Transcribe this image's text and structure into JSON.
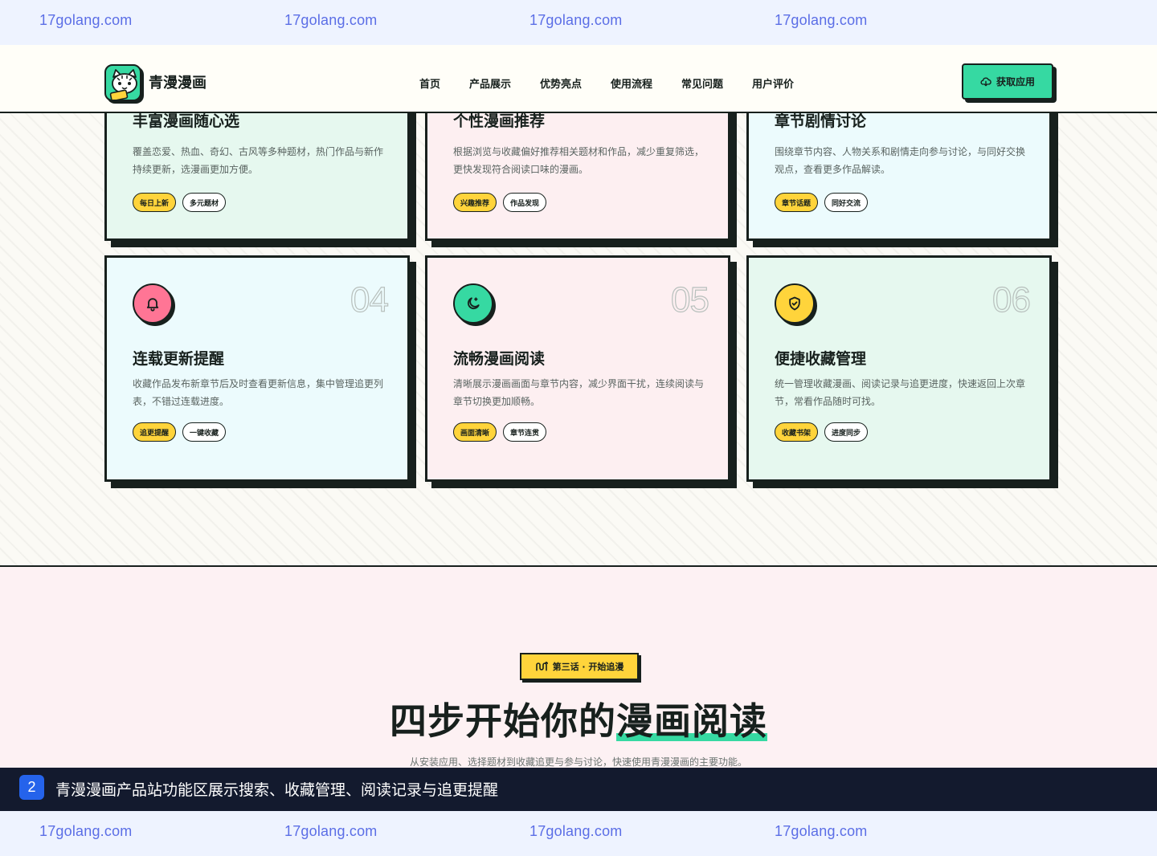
{
  "watermark": {
    "text": "17golang.com",
    "count": 4
  },
  "header": {
    "brand": "青漫漫画",
    "logo_icon": "cat-mascot-icon",
    "nav": [
      {
        "label": "首页"
      },
      {
        "label": "产品展示"
      },
      {
        "label": "优势亮点"
      },
      {
        "label": "使用流程"
      },
      {
        "label": "常见问题"
      },
      {
        "label": "用户评价"
      }
    ],
    "cta_label": "获取应用",
    "cta_icon": "cloud-download-icon"
  },
  "features": {
    "cards": [
      {
        "title": "丰富漫画随心选",
        "desc": "覆盖恋爱、热血、奇幻、古风等多种题材，热门作品与新作持续更新，选漫画更加方便。",
        "tags": [
          "每日上新",
          "多元题材"
        ],
        "theme": "mint"
      },
      {
        "title": "个性漫画推荐",
        "desc": "根据浏览与收藏偏好推荐相关题材和作品，减少重复筛选，更快发现符合阅读口味的漫画。",
        "tags": [
          "兴趣推荐",
          "作品发现"
        ],
        "theme": "pink"
      },
      {
        "title": "章节剧情讨论",
        "desc": "围绕章节内容、人物关系和剧情走向参与讨论，与同好交换观点，查看更多作品解读。",
        "tags": [
          "章节话题",
          "同好交流"
        ],
        "theme": "cyan"
      },
      {
        "number": "04",
        "icon": "bell-icon",
        "icon_color": "#ff7595",
        "title": "连载更新提醒",
        "desc": "收藏作品发布新章节后及时查看更新信息，集中管理追更列表，不错过连载进度。",
        "tags": [
          "追更提醒",
          "一键收藏"
        ],
        "theme": "cyan"
      },
      {
        "number": "05",
        "icon": "moon-star-icon",
        "icon_color": "#36d9a2",
        "title": "流畅漫画阅读",
        "desc": "清晰展示漫画画面与章节内容，减少界面干扰，连续阅读与章节切换更加顺畅。",
        "tags": [
          "画面清晰",
          "章节连贯"
        ],
        "theme": "pink"
      },
      {
        "number": "06",
        "icon": "shield-check-icon",
        "icon_color": "#ffd43b",
        "title": "便捷收藏管理",
        "desc": "统一管理收藏漫画、阅读记录与追更进度，快速返回上次章节，常看作品随时可找。",
        "tags": [
          "收藏书架",
          "进度同步"
        ],
        "theme": "mint"
      }
    ]
  },
  "steps": {
    "chapter_label": "第三话 · 开始追漫",
    "chapter_icon": "route-icon",
    "title_plain": "四步开始你的",
    "title_highlight": "漫画阅读",
    "subtitle": "从安装应用、选择题材到收藏追更与参与讨论，快速使用青漫漫画的主要功能。"
  },
  "caption": {
    "number": "2",
    "text": "青漫漫画产品站功能区展示搜索、收藏管理、阅读记录与追更提醒"
  },
  "colors": {
    "ink": "#17201d",
    "mint": "#36d9a2",
    "yellow": "#ffd43b",
    "pink": "#ff7595",
    "watermark": "#5b6ee6",
    "caption_bg": "#131a2e"
  }
}
